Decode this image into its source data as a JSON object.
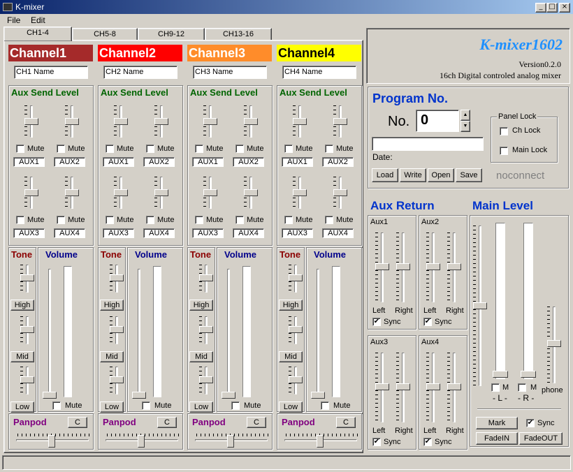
{
  "window": {
    "title": "K-mixer"
  },
  "menu": [
    "File",
    "Edit"
  ],
  "tabs": [
    "CH1-4",
    "CH5-8",
    "CH9-12",
    "CH13-16"
  ],
  "channels": [
    {
      "header": "Channel1",
      "color": "#a52a2a",
      "name": "CH1 Name",
      "aux": [
        "AUX1",
        "AUX2",
        "AUX3",
        "AUX4"
      ]
    },
    {
      "header": "Channel2",
      "color": "#ff0000",
      "name": "CH2 Name",
      "aux": [
        "AUX1",
        "AUX2",
        "AUX3",
        "AUX4"
      ]
    },
    {
      "header": "Channel3",
      "color": "#ff8c2a",
      "name": "CH3 Name",
      "aux": [
        "AUX1",
        "AUX2",
        "AUX3",
        "AUX4"
      ]
    },
    {
      "header": "Channel4",
      "color": "#ffff00",
      "name": "CH4 Name",
      "aux": [
        "AUX1",
        "AUX2",
        "AUX3",
        "AUX4"
      ]
    }
  ],
  "labels": {
    "aux_send": "Aux Send Level",
    "mute": "Mute",
    "tone": "Tone",
    "volume": "Volume",
    "high": "High",
    "mid": "Mid",
    "low": "Low",
    "panpod": "Panpod",
    "center": "C"
  },
  "brand": {
    "title": "K-mixer1602",
    "version": "Version0.2.0",
    "subtitle": "16ch Digital controled analog mixer"
  },
  "program": {
    "title": "Program No.",
    "no_label": "No.",
    "value": "0",
    "date_label": "Date:",
    "buttons": [
      "Load",
      "Write",
      "Open",
      "Save"
    ],
    "status": "noconnect"
  },
  "panel_lock": {
    "title": "Panel Lock",
    "ch_lock": "Ch Lock",
    "main_lock": "Main Lock"
  },
  "aux_return": {
    "title": "Aux Return",
    "groups": [
      "Aux1",
      "Aux2",
      "Aux3",
      "Aux4"
    ],
    "left": "Left",
    "right": "Right",
    "sync": "Sync"
  },
  "main_level": {
    "title": "Main Level",
    "m": "M",
    "l": "- L -",
    "r": "- R -",
    "phone": "phone",
    "mark": "Mark",
    "sync": "Sync",
    "fadein": "FadeIN",
    "fadeout": "FadeOUT"
  },
  "colors": {
    "accent_blue": "#1e90ff",
    "prog_blue": "#0033cc"
  }
}
